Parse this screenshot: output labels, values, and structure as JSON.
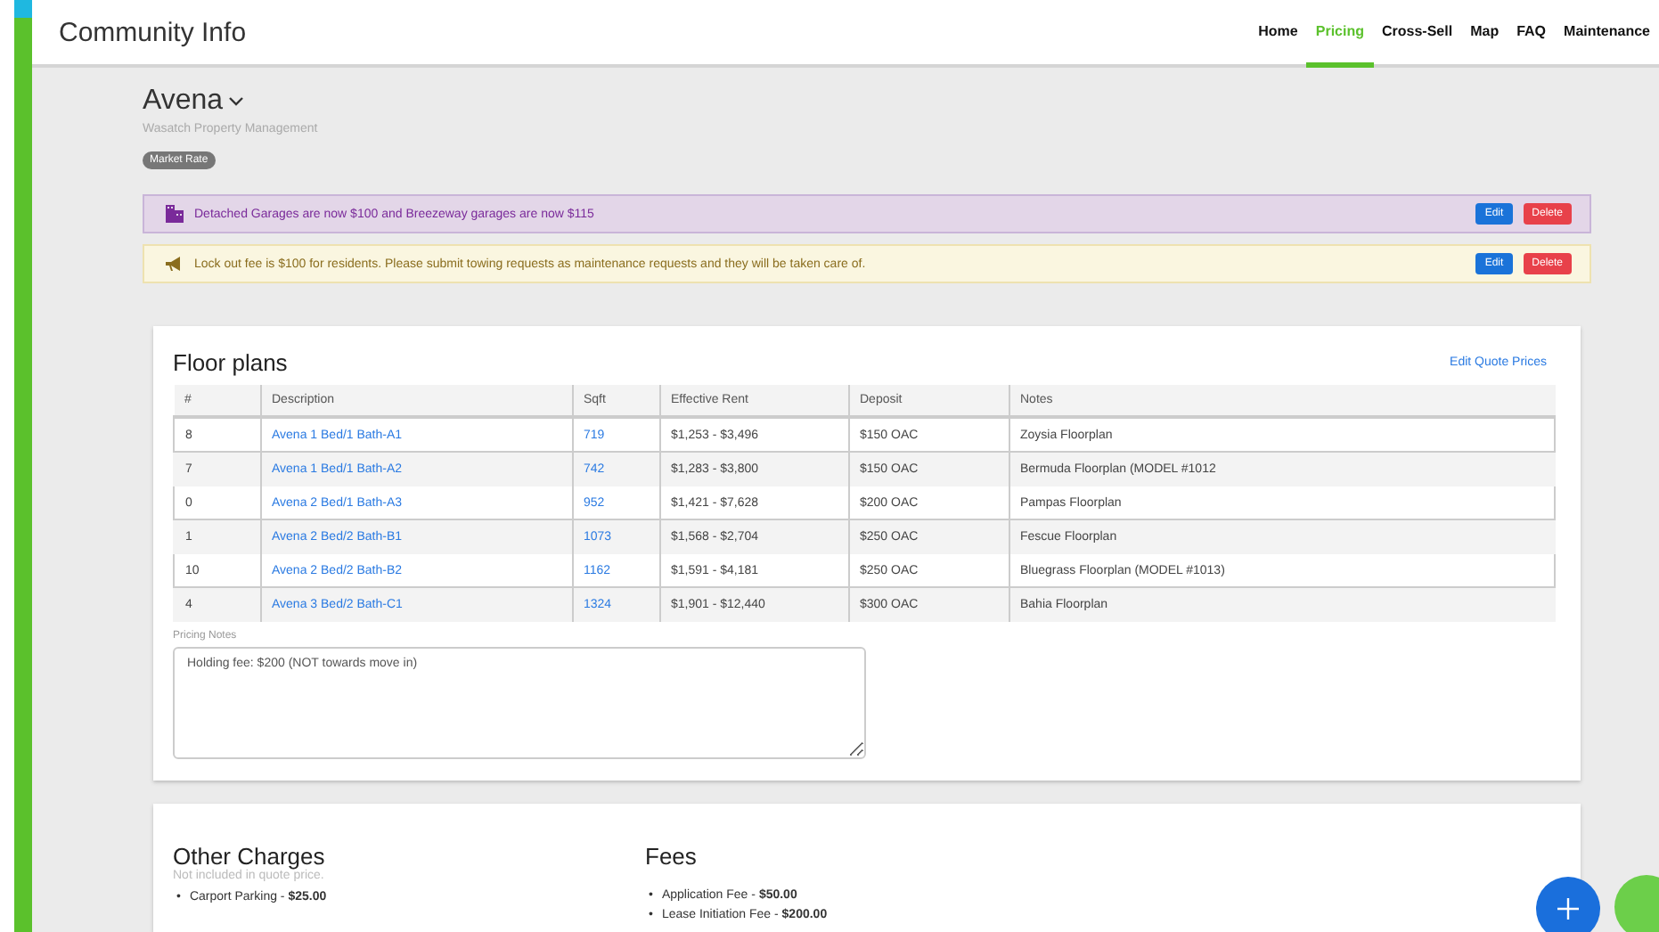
{
  "header": {
    "title": "Community Info",
    "nav": [
      {
        "label": "Home",
        "selected": false
      },
      {
        "label": "Pricing",
        "selected": true
      },
      {
        "label": "Cross-Sell",
        "selected": false
      },
      {
        "label": "Map",
        "selected": false
      },
      {
        "label": "FAQ",
        "selected": false
      },
      {
        "label": "Maintenance",
        "selected": false
      }
    ]
  },
  "property": {
    "name": "Avena",
    "company": "Wasatch Property Management",
    "badge": "Market Rate"
  },
  "alerts": [
    {
      "kind": "building",
      "text": "Detached Garages are now $100 and Breezeway garages are now $115",
      "buttons": [
        "Edit",
        "Delete"
      ]
    },
    {
      "kind": "megaphone",
      "text": "Lock out fee is $100 for residents. Please submit towing requests as maintenance requests and they will be taken care of.",
      "buttons": [
        "Edit",
        "Delete"
      ]
    }
  ],
  "floor_plans": {
    "title": "Floor plans",
    "action": "Edit Quote Prices",
    "columns": [
      "#",
      "Description",
      "Sqft",
      "Effective Rent",
      "Deposit",
      "Notes"
    ],
    "rows": [
      [
        "8",
        "Avena 1 Bed/1 Bath-A1",
        "719",
        "$1,253 - $3,496",
        "$150 OAC",
        "Zoysia Floorplan"
      ],
      [
        "7",
        "Avena 1 Bed/1 Bath-A2",
        "742",
        "$1,283 - $3,800",
        "$150 OAC",
        "Bermuda Floorplan (MODEL #1012"
      ],
      [
        "0",
        "Avena 2 Bed/1 Bath-A3",
        "952",
        "$1,421 - $7,628",
        "$200 OAC",
        "Pampas Floorplan"
      ],
      [
        "1",
        "Avena 2 Bed/2 Bath-B1",
        "1073",
        "$1,568 - $2,704",
        "$250 OAC",
        "Fescue Floorplan"
      ],
      [
        "10",
        "Avena 2 Bed/2 Bath-B2",
        "1162",
        "$1,591 - $4,181",
        "$250 OAC",
        "Bluegrass Floorplan (MODEL #1013)"
      ],
      [
        "4",
        "Avena 3 Bed/2 Bath-C1",
        "1324",
        "$1,901 - $12,440",
        "$300 OAC",
        "Bahia Floorplan"
      ]
    ],
    "notes_label": "Pricing Notes",
    "notes_value": "Holding fee: $200 (NOT towards move in)"
  },
  "other_charges": {
    "title": "Other Charges",
    "subtitle": "Not included in quote price.",
    "items": [
      {
        "marker": "•",
        "text": "Carport Parking - **$25.00**"
      }
    ]
  },
  "fees": {
    "title": "Fees",
    "items": [
      {
        "marker": "•",
        "text": "Application Fee - **$50.00**"
      },
      {
        "marker": "•",
        "text": "Lease Initiation Fee - **$200.00**"
      }
    ]
  }
}
